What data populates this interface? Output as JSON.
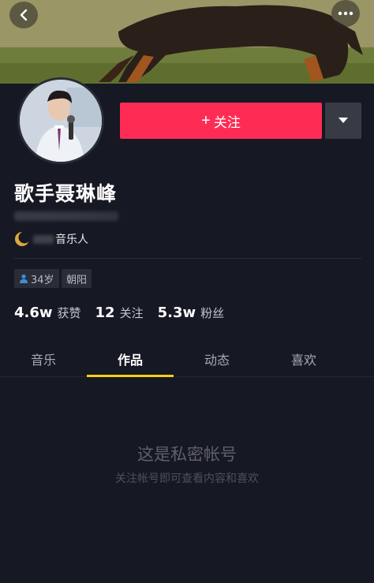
{
  "header": {
    "back_icon": "chevron-left-icon",
    "more_icon": "more-dots-icon"
  },
  "profile": {
    "name": "歌手聂琳峰",
    "certification": "音乐人",
    "certification_icon": "crescent-badge-icon",
    "follow_label": "关注",
    "follow_color": "#fe2c55",
    "tags": [
      {
        "icon": "person-icon",
        "label": "34岁"
      },
      {
        "label": "朝阳"
      }
    ]
  },
  "stats": [
    {
      "value": "4.6w",
      "label": "获赞"
    },
    {
      "value": "12",
      "label": "关注"
    },
    {
      "value": "5.3w",
      "label": "粉丝"
    }
  ],
  "tabs": [
    {
      "label": "音乐",
      "active": false
    },
    {
      "label": "作品",
      "active": true
    },
    {
      "label": "动态",
      "active": false
    },
    {
      "label": "喜欢",
      "active": false
    }
  ],
  "private_notice": {
    "title": "这是私密帐号",
    "subtitle": "关注帐号即可查看内容和喜欢"
  },
  "colors": {
    "background": "#161823",
    "accent": "#fe2c55",
    "tab_indicator": "#face15"
  }
}
